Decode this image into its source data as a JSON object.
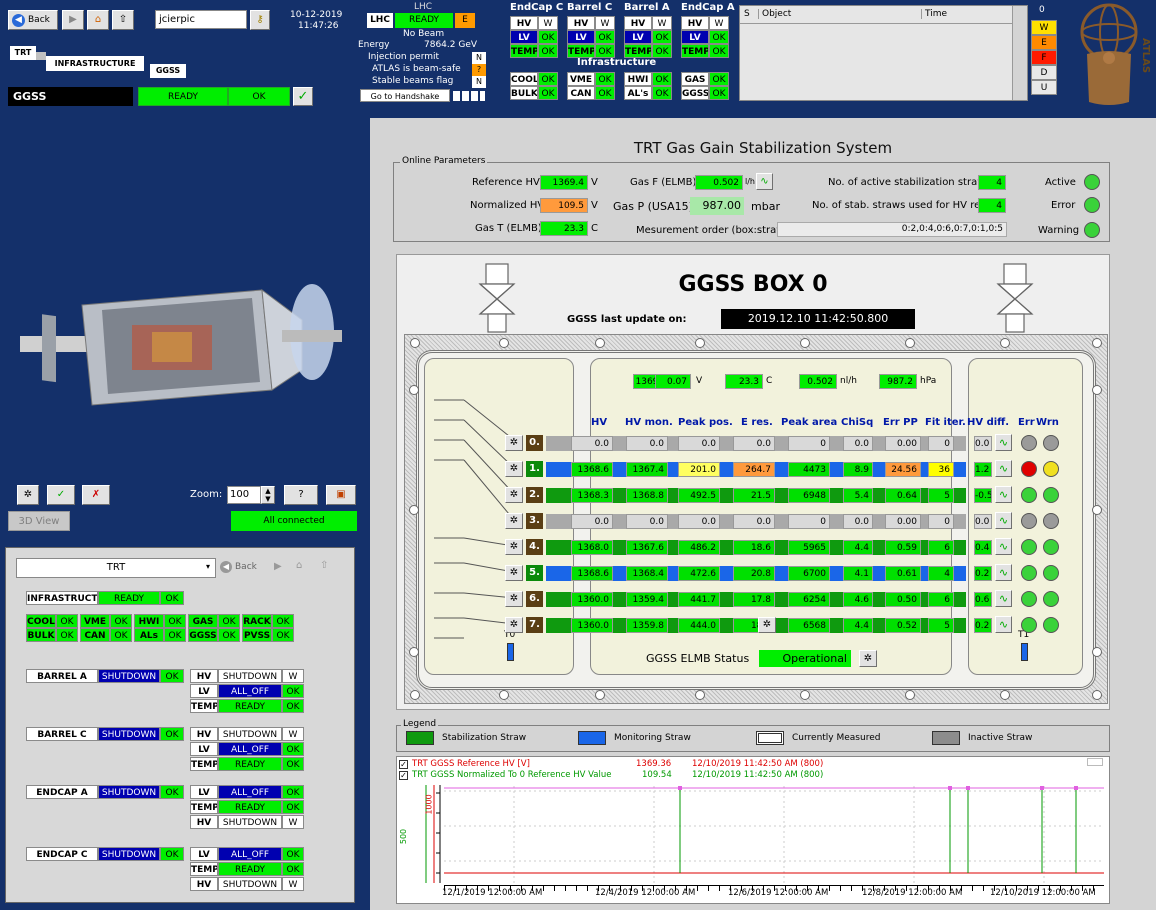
{
  "topbar": {
    "username": "jcierpic",
    "date": "10-12-2019",
    "time": "11:47:26",
    "back": "Back"
  },
  "breadcrumb": {
    "trt": "TRT",
    "infrastructure": "INFRASTRUCTURE",
    "ggss": "GGSS"
  },
  "node": {
    "name": "GGSS",
    "state": "READY",
    "status": "OK"
  },
  "lhc": {
    "title": "LHC",
    "badge": "LHC",
    "state": "READY",
    "flag": "E",
    "line1": "No Beam",
    "energy_label": "Energy",
    "energy_value": "7864.2 GeV",
    "injection": "Injection permit",
    "inj_flag": "N",
    "beam_safe": "ATLAS is beam-safe",
    "safe_flag": "?",
    "stable": "Stable beams flag",
    "stable_flag": "N",
    "handshake": "Go to Handshake"
  },
  "detectors": {
    "headers": [
      "EndCap C",
      "Barrel C",
      "Barrel A",
      "EndCap A"
    ],
    "rows": [
      "HV",
      "LV",
      "TEMP"
    ],
    "hv_val": "W",
    "ok": "OK"
  },
  "infra": {
    "title": "Infrastructure",
    "items": [
      [
        "COOL",
        "OK"
      ],
      [
        "VME",
        "OK"
      ],
      [
        "HWI",
        "OK"
      ],
      [
        "GAS",
        "OK"
      ],
      [
        "BULK",
        "OK"
      ],
      [
        "CAN",
        "OK"
      ],
      [
        "AL's",
        "OK"
      ],
      [
        "GGSS",
        "OK"
      ]
    ]
  },
  "alarms": {
    "s": "S",
    "object": "Object",
    "time": "Time",
    "count": "0",
    "levels": [
      "W",
      "E",
      "F",
      "D",
      "U"
    ]
  },
  "atlas": "ATLAS",
  "left_tools": {
    "zoom_label": "Zoom:",
    "zoom": "100",
    "view3d": "3D View",
    "connected": "All connected"
  },
  "trt_panel": {
    "selector": "TRT",
    "back": "Back",
    "infra_name": "INFRASTRUCT",
    "infra_state": "READY",
    "infra_status": "OK",
    "services": [
      [
        "COOL",
        "OK"
      ],
      [
        "VME",
        "OK"
      ],
      [
        "HWI",
        "OK"
      ],
      [
        "GAS",
        "OK"
      ],
      [
        "RACK",
        "OK"
      ],
      [
        "BULK",
        "OK"
      ],
      [
        "CAN",
        "OK"
      ],
      [
        "ALs",
        "OK"
      ],
      [
        "GGSS",
        "OK"
      ],
      [
        "PVSS",
        "OK"
      ]
    ],
    "parts": [
      {
        "name": "BARREL A",
        "state": "SHUTDOWN",
        "status": "OK",
        "rows": [
          [
            "HV",
            "SHUTDOWN",
            "W"
          ],
          [
            "LV",
            "ALL_OFF",
            "OK"
          ],
          [
            "TEMP",
            "READY",
            "OK"
          ]
        ]
      },
      {
        "name": "BARREL C",
        "state": "SHUTDOWN",
        "status": "OK",
        "rows": [
          [
            "HV",
            "SHUTDOWN",
            "W"
          ],
          [
            "LV",
            "ALL_OFF",
            "OK"
          ],
          [
            "TEMP",
            "READY",
            "OK"
          ]
        ]
      },
      {
        "name": "ENDCAP A",
        "state": "SHUTDOWN",
        "status": "OK",
        "rows": [
          [
            "LV",
            "ALL_OFF",
            "OK"
          ],
          [
            "TEMP",
            "READY",
            "OK"
          ],
          [
            "HV",
            "SHUTDOWN",
            "W"
          ]
        ]
      },
      {
        "name": "ENDCAP C",
        "state": "SHUTDOWN",
        "status": "OK",
        "rows": [
          [
            "LV",
            "ALL_OFF",
            "OK"
          ],
          [
            "TEMP",
            "READY",
            "OK"
          ],
          [
            "HV",
            "SHUTDOWN",
            "W"
          ]
        ]
      }
    ]
  },
  "main": {
    "title": "TRT Gas Gain Stabilization System",
    "online_params": "Online Parameters",
    "ref_hv_label": "Reference HV",
    "ref_hv": "1369.4",
    "ref_hv_unit": "V",
    "norm_hv_label": "Normalized HV",
    "norm_hv": "109.5",
    "norm_hv_unit": "V",
    "gas_t_label": "Gas T (ELMB)",
    "gas_t": "23.3",
    "gas_t_unit": "C",
    "gas_f_label": "Gas F (ELMB)",
    "gas_f": "0.502",
    "gas_f_unit": "l/h",
    "gas_p_label": "Gas P (USA15)",
    "gas_p": "987.00",
    "gas_p_unit": "mbar",
    "active_label": "No. of active stabilization straws",
    "active": "4",
    "used_label": "No. of stab. straws used for HV ref.",
    "used": "4",
    "order_label": "Mesurement order (box:straw)",
    "order": "0:2,0:4,0:6,0:7,0:1,0:5",
    "st_active": "Active",
    "st_error": "Error",
    "st_warning": "Warning"
  },
  "box": {
    "title": "GGSS BOX 0",
    "update_label": "GGSS last update on:",
    "update": "2019.12.10 11:42:50.800",
    "top_hv": "1369.4",
    "pm": "±",
    "top_hv_err": "0.07",
    "v": "V",
    "top_t": "23.3",
    "c": "C",
    "top_f": "0.502",
    "nlh": "nl/h",
    "top_p": "987.2",
    "hpa": "hPa",
    "headers": [
      "HV",
      "HV mon.",
      "Peak pos.",
      "E res.",
      "Peak area",
      "ChiSq",
      "Err PP",
      "Fit iter.",
      "HV diff.",
      "Err",
      "Wrn"
    ],
    "rows": [
      {
        "id": "0.",
        "hv": "0.0",
        "mon": "0.0",
        "peak": "0.0",
        "eres": "0.0",
        "area": "0",
        "chi": "0.0",
        "errpp": "0.00",
        "fit": "0",
        "diff": "0.0",
        "type": "inactive",
        "err": "grey",
        "wrn": "grey"
      },
      {
        "id": "1.",
        "hv": "1368.6",
        "mon": "1367.4",
        "peak": "201.0",
        "eres": "264.7",
        "area": "4473",
        "chi": "8.9",
        "errpp": "24.56",
        "fit": "36",
        "diff": "1.2",
        "type": "monitor",
        "err": "red",
        "wrn": "yellow"
      },
      {
        "id": "2.",
        "hv": "1368.3",
        "mon": "1368.8",
        "peak": "492.5",
        "eres": "21.5",
        "area": "6948",
        "chi": "5.4",
        "errpp": "0.64",
        "fit": "5",
        "diff": "-0.5",
        "type": "stab",
        "err": "green",
        "wrn": "green"
      },
      {
        "id": "3.",
        "hv": "0.0",
        "mon": "0.0",
        "peak": "0.0",
        "eres": "0.0",
        "area": "0",
        "chi": "0.0",
        "errpp": "0.00",
        "fit": "0",
        "diff": "0.0",
        "type": "inactive",
        "err": "grey",
        "wrn": "grey"
      },
      {
        "id": "4.",
        "hv": "1368.0",
        "mon": "1367.6",
        "peak": "486.2",
        "eres": "18.6",
        "area": "5965",
        "chi": "4.4",
        "errpp": "0.59",
        "fit": "6",
        "diff": "0.4",
        "type": "stab",
        "err": "green",
        "wrn": "green"
      },
      {
        "id": "5.",
        "hv": "1368.6",
        "mon": "1368.4",
        "peak": "472.6",
        "eres": "20.8",
        "area": "6700",
        "chi": "4.1",
        "errpp": "0.61",
        "fit": "4",
        "diff": "0.2",
        "type": "monitor",
        "err": "green",
        "wrn": "green"
      },
      {
        "id": "6.",
        "hv": "1360.0",
        "mon": "1359.4",
        "peak": "441.7",
        "eres": "17.8",
        "area": "6254",
        "chi": "4.6",
        "errpp": "0.50",
        "fit": "6",
        "diff": "0.6",
        "type": "stab",
        "err": "green",
        "wrn": "green"
      },
      {
        "id": "7.",
        "hv": "1360.0",
        "mon": "1359.8",
        "peak": "444.0",
        "eres": "18.8",
        "area": "6568",
        "chi": "4.4",
        "errpp": "0.52",
        "fit": "5",
        "diff": "0.2",
        "type": "stab",
        "err": "green",
        "wrn": "green"
      }
    ],
    "t0": "T0",
    "t1": "T1",
    "elmb_label": "GGSS ELMB Status",
    "elmb": "Operational"
  },
  "legend": {
    "title": "Legend",
    "stab": "Stabilization Straw",
    "mon": "Monitoring Straw",
    "cur": "Currently Measured",
    "inact": "Inactive Straw"
  },
  "trend": {
    "s1": "TRT GGSS Reference HV [V]",
    "s1v": "1369.36",
    "s1t": "12/10/2019 11:42:50 AM (800)",
    "s2": "TRT GGSS Normalized To 0 Reference HV Value",
    "s2v": "109.54",
    "s2t": "12/10/2019 11:42:50 AM (800)",
    "y1": "1000",
    "y2": "500",
    "x": [
      "12/1/2019 12:00:00 AM",
      "12/4/2019 12:00:00 AM",
      "12/6/2019 12:00:00 AM",
      "12/8/2019 12:00:00 AM",
      "12/10/2019 12:00:00 AM"
    ]
  }
}
